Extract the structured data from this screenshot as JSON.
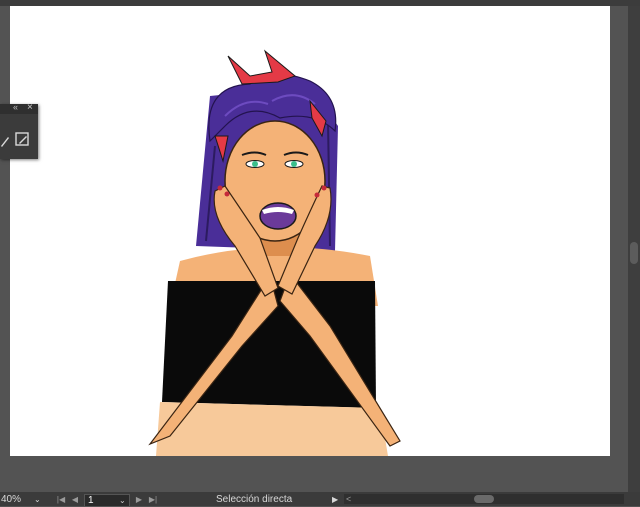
{
  "status_bar": {
    "zoom": "40%",
    "page": "1",
    "tool_status": "Selección directa"
  },
  "icons": {
    "panel_collapse": "«",
    "panel_close": "×",
    "dropdown": "⌄",
    "first": "|◀",
    "prev": "◀",
    "next": "▶",
    "last": "▶|",
    "status_menu": "▶",
    "scroll_left": "<"
  },
  "colors": {
    "skin": "#f4b277",
    "skin_shadow": "#dd8e4e",
    "hair": "#4a2e98",
    "hair_light": "#6d4bc0",
    "bandana": "#e43a46",
    "top": "#0a0a0a",
    "eyes": "#3bbf8c",
    "lips": "#6b3a9a"
  }
}
